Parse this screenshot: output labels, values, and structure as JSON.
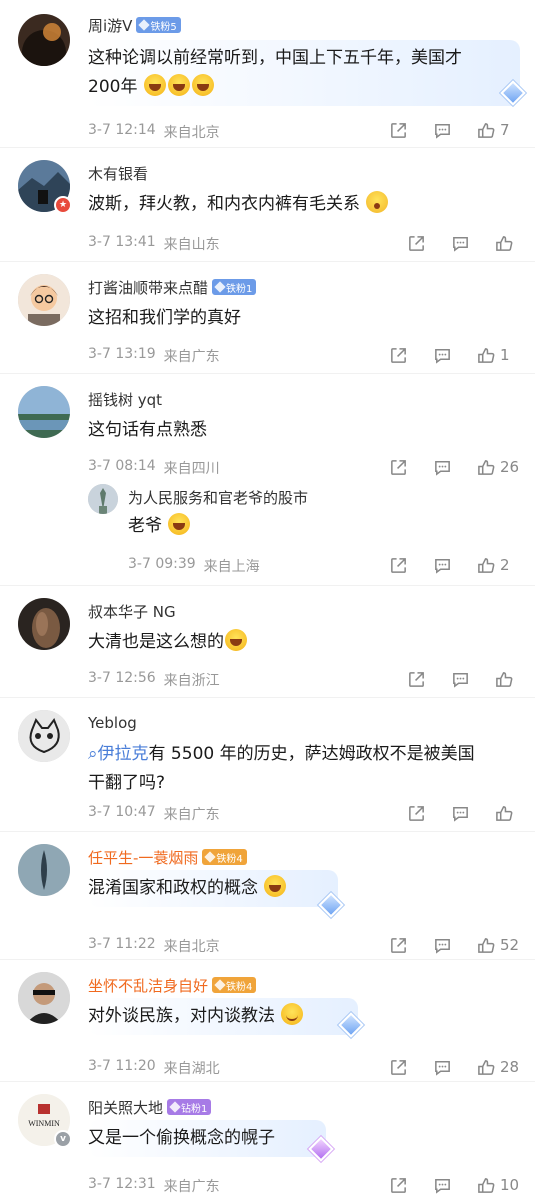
{
  "comments": [
    {
      "name": "周i游V",
      "fan": "铁粉5",
      "text1": "这种论调以前经常听到，中国上下五千年，美国才",
      "text2": "200年",
      "time": "3-7 12:14",
      "loc": "来自北京",
      "likes": "7"
    },
    {
      "name": "木有银看",
      "text1": "波斯，拜火教，和内衣内裤有毛关系",
      "time": "3-7 13:41",
      "loc": "来自山东",
      "likes": ""
    },
    {
      "name": "打酱油顺带来点醋",
      "fan": "铁粉1",
      "text1": "这招和我们学的真好",
      "time": "3-7 13:19",
      "loc": "来自广东",
      "likes": "1"
    },
    {
      "name": "摇钱树 yqt",
      "text1": "这句话有点熟悉",
      "time": "3-7 08:14",
      "loc": "来自四川",
      "likes": "26"
    },
    {
      "name": "为人民服务和官老爷的股市",
      "text1": "老爷",
      "time": "3-7 09:39",
      "loc": "来自上海",
      "likes": "2"
    },
    {
      "name": "叔本华子 NG",
      "text1": "大清也是这么想的",
      "time": "3-7 12:56",
      "loc": "来自浙江",
      "likes": ""
    },
    {
      "name": "Yeblog",
      "topic": "伊拉克",
      "text1": "有 5500 年的历史，萨达姆政权不是被美国",
      "text2": "干翻了吗?",
      "time": "3-7 10:47",
      "loc": "来自广东",
      "likes": ""
    },
    {
      "name": "任平生-一蓑烟雨",
      "fan": "铁粉4",
      "text1": "混淆国家和政权的概念",
      "time": "3-7 11:22",
      "loc": "来自北京",
      "likes": "52"
    },
    {
      "name": "坐怀不乱洁身自好",
      "fan": "铁粉4",
      "text1": "对外谈民族，对内谈教法",
      "time": "3-7 11:20",
      "loc": "来自湖北",
      "likes": "28"
    },
    {
      "name": "阳关照大地",
      "fan": "钻粉1",
      "avatar_text": "WINMIN",
      "text1": "又是一个偷换概念的幌子",
      "time": "3-7 12:31",
      "loc": "来自广东",
      "likes": "10"
    }
  ],
  "colors": {
    "accent": "#4a7ed8",
    "vip_name": "#f06a1f",
    "meta": "#999999"
  },
  "icons": [
    "share-icon",
    "comment-icon",
    "like-icon",
    "fan-badge-icon",
    "gem-icon"
  ]
}
